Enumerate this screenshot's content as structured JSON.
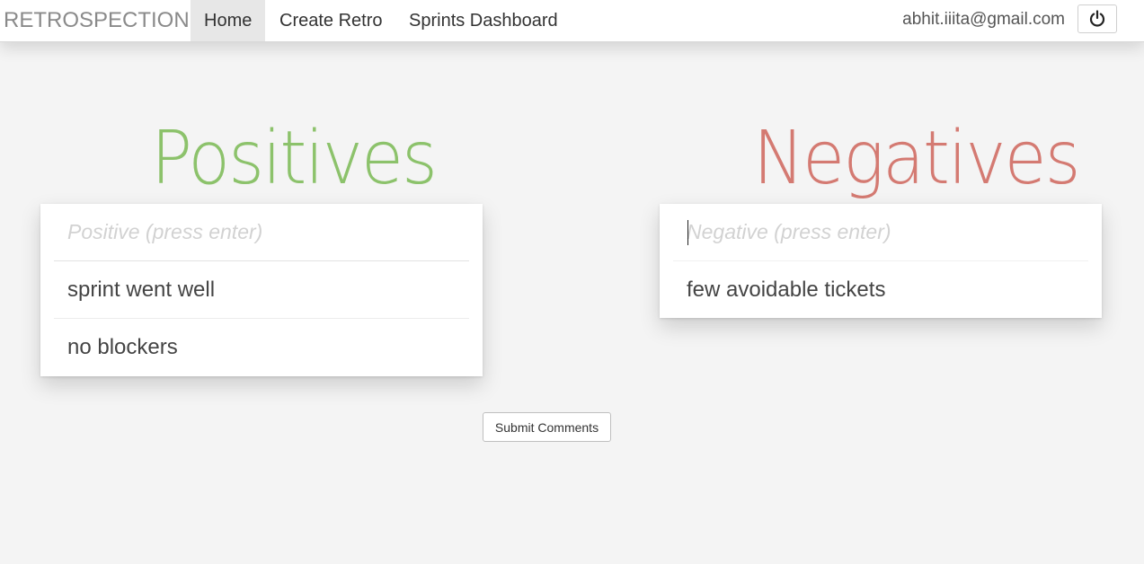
{
  "navbar": {
    "brand": "RETROSPECTION",
    "items": [
      {
        "label": "Home",
        "active": true
      },
      {
        "label": "Create Retro",
        "active": false
      },
      {
        "label": "Sprints Dashboard",
        "active": false
      }
    ],
    "user_email": "abhit.iiita@gmail.com",
    "logout_icon": "power-icon"
  },
  "positives": {
    "title": "Positives",
    "color": "#8cc26b",
    "placeholder": "Positive (press enter)",
    "items": [
      "sprint went well",
      "no blockers"
    ]
  },
  "negatives": {
    "title": "Negatives",
    "color": "#d47a72",
    "placeholder": "Negative (press enter)",
    "items": [
      "few avoidable tickets"
    ]
  },
  "submit": {
    "label": "Submit Comments"
  }
}
